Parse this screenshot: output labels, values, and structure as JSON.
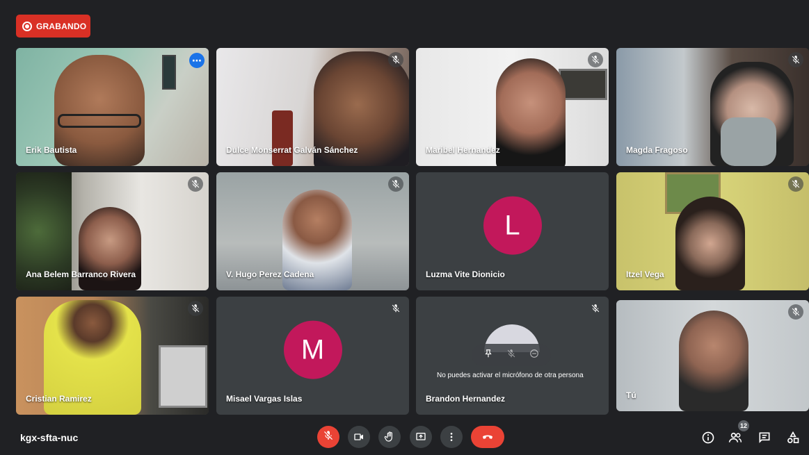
{
  "recording": {
    "label": "GRABANDO",
    "color": "#d93025"
  },
  "tiles": [
    {
      "name": "Erik Bautista",
      "active": true
    },
    {
      "name": "Dulce Monserrat Galván Sánchez"
    },
    {
      "name": "Maribel Hernandez"
    },
    {
      "name": "Magda Fragoso"
    },
    {
      "name": "Ana Belem Barranco Rivera"
    },
    {
      "name": "V. Hugo Perez Cadena"
    },
    {
      "name": "Luzma Vite Dionicio",
      "avatar_letter": "L"
    },
    {
      "name": "Itzel Vega"
    },
    {
      "name": "Cristian Ramirez"
    },
    {
      "name": "Misael Vargas Islas",
      "avatar_letter": "M"
    },
    {
      "name": "Brandon Hernandez",
      "tooltip": "No puedes activar el micrófono de otra persona"
    },
    {
      "name": "Tú"
    }
  ],
  "bottom": {
    "meeting_code": "kgx-sfta-nuc",
    "participant_count": "12"
  },
  "icons": {
    "mic_off": "mic-off-icon",
    "camera": "camera-icon",
    "hand": "raise-hand-icon",
    "present": "present-screen-icon",
    "more": "more-options-icon",
    "end": "end-call-icon",
    "info": "info-icon",
    "people": "people-icon",
    "chat": "chat-icon",
    "activities": "activities-icon"
  },
  "colors": {
    "accent": "#8ab4f8",
    "end_call": "#ea4335",
    "avatar": "#c2185b",
    "background": "#202124"
  }
}
